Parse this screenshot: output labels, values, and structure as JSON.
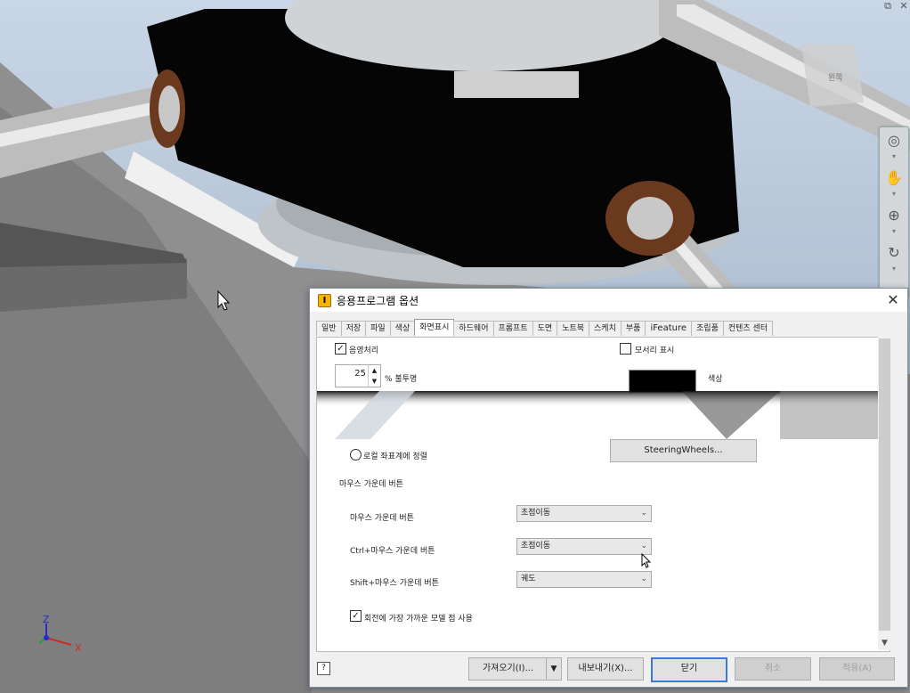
{
  "window_controls": {
    "restore": "⧉",
    "close": "✕"
  },
  "viewcube": {
    "label": "왼쪽"
  },
  "navbar": {
    "items": [
      "full-navigation-wheel",
      "pan",
      "zoom",
      "orbit"
    ]
  },
  "triad": {
    "z": "Z",
    "x": "X"
  },
  "dialog": {
    "title": "응용프로그램 옵션",
    "icon_letter": "I",
    "close": "✕",
    "tabs": [
      "일반",
      "저장",
      "파일",
      "색상",
      "화면표시",
      "하드웨어",
      "프롬프트",
      "도면",
      "노트북",
      "스케치",
      "부품",
      "iFeature",
      "조립품",
      "컨텐츠 센터"
    ],
    "active_tab": "화면표시",
    "shading": {
      "label": "음영처리",
      "checked": true
    },
    "silhouette": {
      "label": "모서리 표시",
      "checked": false
    },
    "transparency": {
      "value": "25",
      "label": "% 불투명"
    },
    "color": {
      "label": "색상",
      "swatch": "#000000"
    },
    "align_local": {
      "label": "로컬 좌표계에 정렬",
      "selected": false
    },
    "steering_button": "SteeringWheels...",
    "middle_mouse": {
      "section": "마우스 가운데 버튼",
      "rows": [
        {
          "label": "마우스 가운데 버튼",
          "value": "초점이동"
        },
        {
          "label": "Ctrl+마우스 가운데 버튼",
          "value": "초점이동"
        },
        {
          "label": "Shift+마우스 가운데 버튼",
          "value": "궤도"
        }
      ]
    },
    "orbit_nearest": {
      "label": "회전에 가장 가까운 모델 점 사용",
      "checked": true
    },
    "footer": {
      "help": "?",
      "import": "가져오기(I)...",
      "export": "내보내기(X)...",
      "close": "닫기",
      "cancel": "취소",
      "apply": "적용(A)"
    }
  }
}
